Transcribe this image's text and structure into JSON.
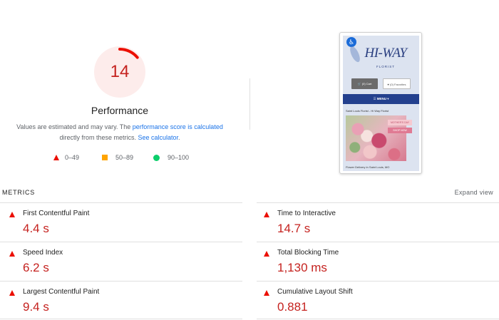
{
  "score": {
    "value": "14",
    "value_fraction": 0.14,
    "color": "#c5221f",
    "track_color": "#fdeceb",
    "arc_color": "#eb0f00",
    "title": "Performance",
    "description_part1": "Values are estimated and may vary. The ",
    "description_link1": "performance score is calculated",
    "description_part2": " directly from these metrics. ",
    "description_link2": "See calculator",
    "description_part3": "."
  },
  "legend": [
    {
      "icon": "red-triangle-icon",
      "range": "0–49",
      "color": "#eb0f00"
    },
    {
      "icon": "orange-square-icon",
      "range": "50–89",
      "color": "#ffa400"
    },
    {
      "icon": "green-circle-icon",
      "range": "90–100",
      "color": "#0cce6b"
    }
  ],
  "screenshot": {
    "logo": "HI-WAY",
    "logo_sub": "FLORIST",
    "cart_label": "🛒 (0) Cart",
    "favorites_label": "♥ (0) Favorites",
    "menu_label": "☰ MENU ▾",
    "breadcrumb": "Saint Louis Florist - Hi Way Florist",
    "badge1": "MOTHER'S DAY",
    "badge2": "SHOP NOW",
    "footer": "Flower Delivery in Saint Louis, MO"
  },
  "metrics_section": {
    "label": "METRICS",
    "expand_label": "Expand view"
  },
  "metrics": [
    {
      "name": "First Contentful Paint",
      "value": "4.4 s"
    },
    {
      "name": "Time to Interactive",
      "value": "14.7 s"
    },
    {
      "name": "Speed Index",
      "value": "6.2 s"
    },
    {
      "name": "Total Blocking Time",
      "value": "1,130 ms"
    },
    {
      "name": "Largest Contentful Paint",
      "value": "9.4 s"
    },
    {
      "name": "Cumulative Layout Shift",
      "value": "0.881"
    }
  ]
}
